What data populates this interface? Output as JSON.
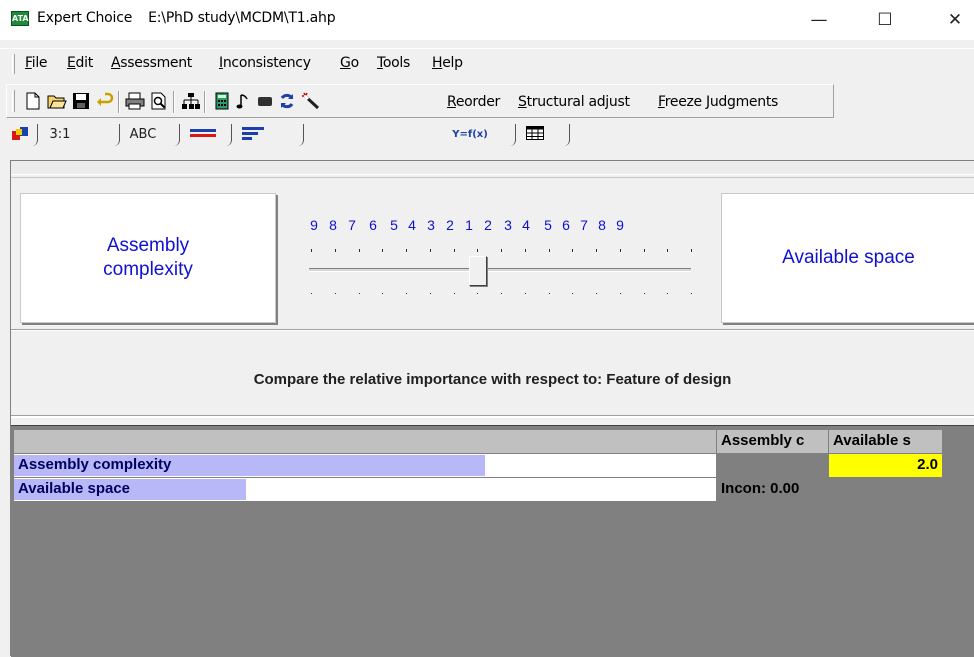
{
  "window": {
    "app_name": "Expert Choice",
    "file_path": "E:\\PhD study\\MCDM\\T1.ahp",
    "icon_label": "ATA",
    "controls": {
      "minimize": "—",
      "maximize": "☐",
      "close": "✕"
    }
  },
  "menu": {
    "items": [
      "File",
      "Edit",
      "Assessment",
      "Inconsistency",
      "Go",
      "Tools",
      "Help"
    ]
  },
  "toolbar": {
    "icons": [
      "new-file-icon",
      "open-folder-icon",
      "save-disk-icon",
      "undo-arrow-icon",
      "print-icon",
      "print-preview-icon",
      "hierarchy-icon",
      "calculator-icon",
      "note-icon",
      "rectangle-icon",
      "refresh-icon",
      "magic-wand-icon"
    ],
    "reorder_label": "Reorder",
    "structural_adjust_label": "Structural adjust",
    "freeze_label": "Freeze Judgments"
  },
  "tabs": [
    {
      "id": "tab-model",
      "icon": "model-view-icon"
    },
    {
      "id": "tab-numerical",
      "label": "3:1"
    },
    {
      "id": "tab-verbal",
      "label": "ABC"
    },
    {
      "id": "tab-graphical",
      "icon": "graphical-bars-icon"
    },
    {
      "id": "tab-questionnaire",
      "icon": "questionnaire-lines-icon"
    },
    {
      "id": "tab-formula",
      "label": "Y=f(x)"
    },
    {
      "id": "tab-grid",
      "icon": "grid-table-icon"
    }
  ],
  "comparison": {
    "left_element": "Assembly complexity",
    "right_element": "Available space",
    "scale_left": [
      "9",
      "8",
      "7",
      "6",
      "5",
      "4",
      "3",
      "2"
    ],
    "scale_center": "1",
    "scale_right": [
      "2",
      "3",
      "4",
      "5",
      "6",
      "7",
      "8",
      "9"
    ],
    "slider_value": 2,
    "slider_side": "left",
    "prompt": "Compare the relative importance  with respect to: Feature of design"
  },
  "matrix": {
    "headers": [
      "",
      "Assembly c",
      "Available s"
    ],
    "rows": [
      {
        "name": "Assembly complexity",
        "bar_fraction": 0.67,
        "cells": [
          "",
          "2.0"
        ]
      },
      {
        "name": "Available space",
        "bar_fraction": 0.33,
        "cells": [
          "Incon: 0.00",
          ""
        ]
      }
    ],
    "highlight_color": "#ffff00",
    "bar_color": "#b8b8f8"
  },
  "colors": {
    "element_text": "#1010d0",
    "grid_background": "#808080"
  }
}
